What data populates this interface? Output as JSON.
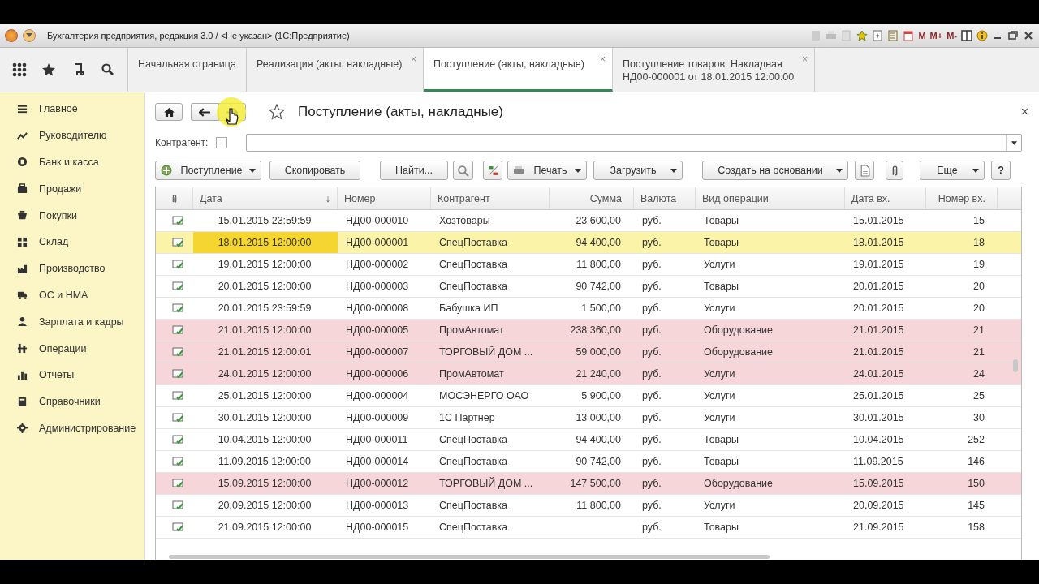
{
  "window": {
    "title": "Бухгалтерия предприятия, редакция 3.0 / <Не указан>  (1С:Предприятие)",
    "memory_buttons": [
      "M",
      "M+",
      "M-"
    ]
  },
  "tabs": [
    {
      "label": "Начальная страница",
      "selected": false
    },
    {
      "label": "Реализация (акты, накладные)",
      "selected": false,
      "close": "×"
    },
    {
      "label": "Поступление (акты, накладные)",
      "selected": true,
      "close": "×"
    },
    {
      "label": "Поступление товаров: Накладная НД00-000001 от 18.01.2015 12:00:00",
      "selected": false,
      "close": "×"
    }
  ],
  "sidebar": {
    "items": [
      "Главное",
      "Руководителю",
      "Банк и касса",
      "Продажи",
      "Покупки",
      "Склад",
      "Производство",
      "ОС и НМА",
      "Зарплата и кадры",
      "Операции",
      "Отчеты",
      "Справочники",
      "Администрирование"
    ]
  },
  "form": {
    "title": "Поступление (акты, накладные)",
    "close": "×",
    "filter": {
      "label": "Контрагент:",
      "checked": false
    },
    "toolbar": [
      {
        "kind": "dropdown",
        "label": "Поступление",
        "icon": true
      },
      {
        "kind": "button",
        "label": "Скопировать"
      },
      {
        "kind": "button",
        "label": "Найти..."
      },
      {
        "kind": "icon"
      },
      {
        "kind": "icon"
      },
      {
        "kind": "dropdown",
        "label": "Печать",
        "icon": true
      },
      {
        "kind": "dropdown",
        "label": "Загрузить"
      },
      {
        "kind": "dropdown",
        "label": "Создать на основании"
      },
      {
        "kind": "icon"
      },
      {
        "kind": "icon"
      },
      {
        "kind": "dropdown",
        "label": "Еще"
      },
      {
        "kind": "button",
        "label": "?"
      }
    ]
  },
  "table": {
    "columns": [
      {
        "label": "Дата",
        "sort_mark": "↓"
      },
      {
        "label": "Номер"
      },
      {
        "label": "Контрагент"
      },
      {
        "label": "Сумма"
      },
      {
        "label": "Валюта"
      },
      {
        "label": "Вид операции"
      },
      {
        "label": "Дата вх."
      },
      {
        "label": "Номер вх."
      }
    ],
    "rows": [
      {
        "selected": false,
        "color": "#ffffff",
        "date": "15.01.2015 23:59:59",
        "number": "НД00-000010",
        "counterparty": "Хозтовары",
        "sum": "23 600,00",
        "currency": "руб.",
        "operation": "Товары",
        "in_date": "15.01.2015",
        "in_number": "15"
      },
      {
        "selected": true,
        "color": "#fbf3a8",
        "date": "18.01.2015 12:00:00",
        "number": "НД00-000001",
        "counterparty": "СпецПоставка",
        "sum": "94 400,00",
        "currency": "руб.",
        "operation": "Товары",
        "in_date": "18.01.2015",
        "in_number": "18"
      },
      {
        "selected": false,
        "color": "#ffffff",
        "date": "19.01.2015 12:00:00",
        "number": "НД00-000002",
        "counterparty": "СпецПоставка",
        "sum": "11 800,00",
        "currency": "руб.",
        "operation": "Услуги",
        "in_date": "19.01.2015",
        "in_number": "19"
      },
      {
        "selected": false,
        "color": "#ffffff",
        "date": "20.01.2015 12:00:00",
        "number": "НД00-000003",
        "counterparty": "СпецПоставка",
        "sum": "90 742,00",
        "currency": "руб.",
        "operation": "Товары",
        "in_date": "20.01.2015",
        "in_number": "20"
      },
      {
        "selected": false,
        "color": "#ffffff",
        "date": "20.01.2015 23:59:59",
        "number": "НД00-000008",
        "counterparty": "Бабушка ИП",
        "sum": "1 500,00",
        "currency": "руб.",
        "operation": "Услуги",
        "in_date": "20.01.2015",
        "in_number": "20"
      },
      {
        "selected": false,
        "color": "#f7d6d9",
        "date": "21.01.2015 12:00:00",
        "number": "НД00-000005",
        "counterparty": "ПромАвтомат",
        "sum": "238 360,00",
        "currency": "руб.",
        "operation": "Оборудование",
        "in_date": "21.01.2015",
        "in_number": "21"
      },
      {
        "selected": false,
        "color": "#f7d6d9",
        "date": "21.01.2015 12:00:01",
        "number": "НД00-000007",
        "counterparty": "ТОРГОВЫЙ ДОМ ...",
        "sum": "59 000,00",
        "currency": "руб.",
        "operation": "Оборудование",
        "in_date": "21.01.2015",
        "in_number": "21"
      },
      {
        "selected": false,
        "color": "#f7d6d9",
        "date": "24.01.2015 12:00:00",
        "number": "НД00-000006",
        "counterparty": "ПромАвтомат",
        "sum": "21 240,00",
        "currency": "руб.",
        "operation": "Услуги",
        "in_date": "24.01.2015",
        "in_number": "24"
      },
      {
        "selected": false,
        "color": "#ffffff",
        "date": "25.01.2015 12:00:00",
        "number": "НД00-000004",
        "counterparty": "МОСЭНЕРГО ОАО",
        "sum": "5 900,00",
        "currency": "руб.",
        "operation": "Услуги",
        "in_date": "25.01.2015",
        "in_number": "25"
      },
      {
        "selected": false,
        "color": "#ffffff",
        "date": "30.01.2015 12:00:00",
        "number": "НД00-000009",
        "counterparty": "1С Партнер",
        "sum": "13 000,00",
        "currency": "руб.",
        "operation": "Услуги",
        "in_date": "30.01.2015",
        "in_number": "30"
      },
      {
        "selected": false,
        "color": "#ffffff",
        "date": "10.04.2015 12:00:00",
        "number": "НД00-000011",
        "counterparty": "СпецПоставка",
        "sum": "94 400,00",
        "currency": "руб.",
        "operation": "Товары",
        "in_date": "10.04.2015",
        "in_number": "252"
      },
      {
        "selected": false,
        "color": "#ffffff",
        "date": "11.09.2015 12:00:00",
        "number": "НД00-000014",
        "counterparty": "СпецПоставка",
        "sum": "90 742,00",
        "currency": "руб.",
        "operation": "Товары",
        "in_date": "11.09.2015",
        "in_number": "146"
      },
      {
        "selected": false,
        "color": "#f7d6d9",
        "date": "15.09.2015 12:00:00",
        "number": "НД00-000012",
        "counterparty": "ТОРГОВЫЙ ДОМ ...",
        "sum": "147 500,00",
        "currency": "руб.",
        "operation": "Оборудование",
        "in_date": "15.09.2015",
        "in_number": "150"
      },
      {
        "selected": false,
        "color": "#ffffff",
        "date": "20.09.2015 12:00:00",
        "number": "НД00-000013",
        "counterparty": "СпецПоставка",
        "sum": "11 800,00",
        "currency": "руб.",
        "operation": "Услуги",
        "in_date": "20.09.2015",
        "in_number": "145"
      },
      {
        "selected": false,
        "color": "#ffffff",
        "date": "21.09.2015 12:00:00",
        "number": "НД00-000015",
        "counterparty": "СпецПоставка",
        "currency": "руб.",
        "operation": "Товары",
        "in_date": "21.09.2015",
        "in_number": "158"
      }
    ]
  }
}
